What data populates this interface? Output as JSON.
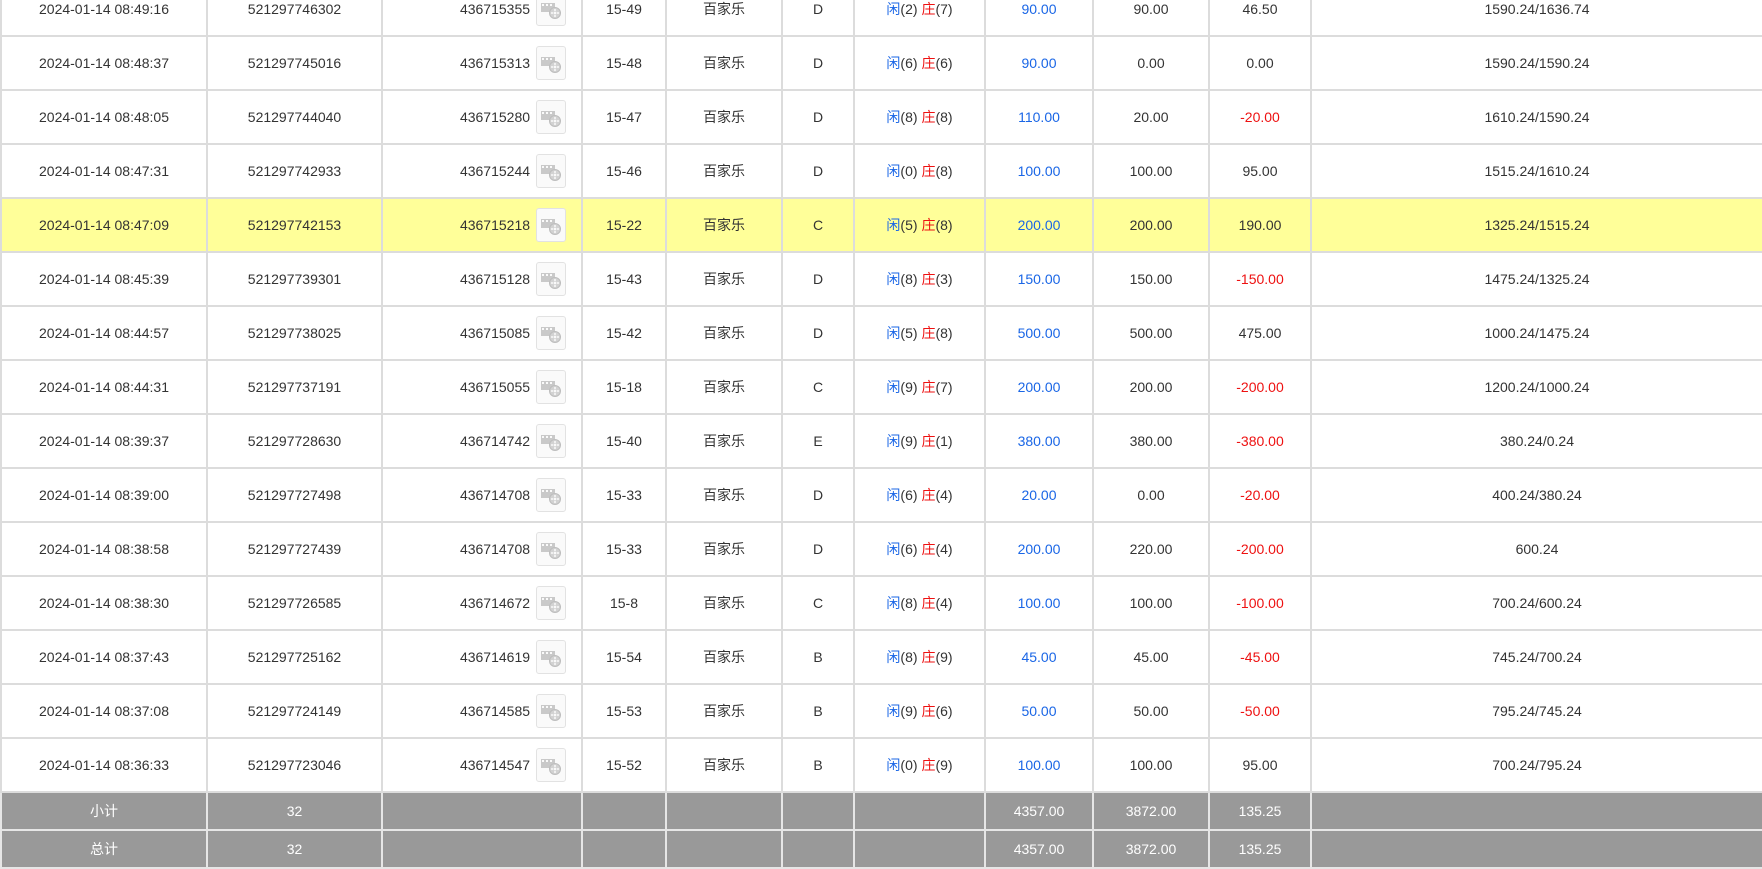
{
  "colors": {
    "player": "#1a66e6",
    "banker": "#ee1111",
    "loss": "#ee1111",
    "highlight": "#ffff99",
    "summary_bg": "#999999"
  },
  "icons": {
    "video": "film-reel-icon"
  },
  "labels": {
    "player": "闲",
    "banker": "庄"
  },
  "rows": [
    {
      "time": "2024-01-14 08:49:16",
      "order_id": "521297746302",
      "round_id": "436715355",
      "shoe": "15-49",
      "game": "百家乐",
      "table": "D",
      "player_pts": "(2)",
      "banker_pts": "(7)",
      "bet": "90.00",
      "valid_bet": "90.00",
      "win_loss": "46.50",
      "negative": false,
      "balance": "1590.24/1636.74",
      "highlight": false
    },
    {
      "time": "2024-01-14 08:48:37",
      "order_id": "521297745016",
      "round_id": "436715313",
      "shoe": "15-48",
      "game": "百家乐",
      "table": "D",
      "player_pts": "(6)",
      "banker_pts": "(6)",
      "bet": "90.00",
      "valid_bet": "0.00",
      "win_loss": "0.00",
      "negative": false,
      "balance": "1590.24/1590.24",
      "highlight": false
    },
    {
      "time": "2024-01-14 08:48:05",
      "order_id": "521297744040",
      "round_id": "436715280",
      "shoe": "15-47",
      "game": "百家乐",
      "table": "D",
      "player_pts": "(8)",
      "banker_pts": "(8)",
      "bet": "110.00",
      "valid_bet": "20.00",
      "win_loss": "-20.00",
      "negative": true,
      "balance": "1610.24/1590.24",
      "highlight": false
    },
    {
      "time": "2024-01-14 08:47:31",
      "order_id": "521297742933",
      "round_id": "436715244",
      "shoe": "15-46",
      "game": "百家乐",
      "table": "D",
      "player_pts": "(0)",
      "banker_pts": "(8)",
      "bet": "100.00",
      "valid_bet": "100.00",
      "win_loss": "95.00",
      "negative": false,
      "balance": "1515.24/1610.24",
      "highlight": false
    },
    {
      "time": "2024-01-14 08:47:09",
      "order_id": "521297742153",
      "round_id": "436715218",
      "shoe": "15-22",
      "game": "百家乐",
      "table": "C",
      "player_pts": "(5)",
      "banker_pts": "(8)",
      "bet": "200.00",
      "valid_bet": "200.00",
      "win_loss": "190.00",
      "negative": false,
      "balance": "1325.24/1515.24",
      "highlight": true
    },
    {
      "time": "2024-01-14 08:45:39",
      "order_id": "521297739301",
      "round_id": "436715128",
      "shoe": "15-43",
      "game": "百家乐",
      "table": "D",
      "player_pts": "(8)",
      "banker_pts": "(3)",
      "bet": "150.00",
      "valid_bet": "150.00",
      "win_loss": "-150.00",
      "negative": true,
      "balance": "1475.24/1325.24",
      "highlight": false
    },
    {
      "time": "2024-01-14 08:44:57",
      "order_id": "521297738025",
      "round_id": "436715085",
      "shoe": "15-42",
      "game": "百家乐",
      "table": "D",
      "player_pts": "(5)",
      "banker_pts": "(8)",
      "bet": "500.00",
      "valid_bet": "500.00",
      "win_loss": "475.00",
      "negative": false,
      "balance": "1000.24/1475.24",
      "highlight": false
    },
    {
      "time": "2024-01-14 08:44:31",
      "order_id": "521297737191",
      "round_id": "436715055",
      "shoe": "15-18",
      "game": "百家乐",
      "table": "C",
      "player_pts": "(9)",
      "banker_pts": "(7)",
      "bet": "200.00",
      "valid_bet": "200.00",
      "win_loss": "-200.00",
      "negative": true,
      "balance": "1200.24/1000.24",
      "highlight": false
    },
    {
      "time": "2024-01-14 08:39:37",
      "order_id": "521297728630",
      "round_id": "436714742",
      "shoe": "15-40",
      "game": "百家乐",
      "table": "E",
      "player_pts": "(9)",
      "banker_pts": "(1)",
      "bet": "380.00",
      "valid_bet": "380.00",
      "win_loss": "-380.00",
      "negative": true,
      "balance": "380.24/0.24",
      "highlight": false
    },
    {
      "time": "2024-01-14 08:39:00",
      "order_id": "521297727498",
      "round_id": "436714708",
      "shoe": "15-33",
      "game": "百家乐",
      "table": "D",
      "player_pts": "(6)",
      "banker_pts": "(4)",
      "bet": "20.00",
      "valid_bet": "0.00",
      "win_loss": "-20.00",
      "negative": true,
      "balance": "400.24/380.24",
      "highlight": false
    },
    {
      "time": "2024-01-14 08:38:58",
      "order_id": "521297727439",
      "round_id": "436714708",
      "shoe": "15-33",
      "game": "百家乐",
      "table": "D",
      "player_pts": "(6)",
      "banker_pts": "(4)",
      "bet": "200.00",
      "valid_bet": "220.00",
      "win_loss": "-200.00",
      "negative": true,
      "balance": "600.24",
      "highlight": false
    },
    {
      "time": "2024-01-14 08:38:30",
      "order_id": "521297726585",
      "round_id": "436714672",
      "shoe": "15-8",
      "game": "百家乐",
      "table": "C",
      "player_pts": "(8)",
      "banker_pts": "(4)",
      "bet": "100.00",
      "valid_bet": "100.00",
      "win_loss": "-100.00",
      "negative": true,
      "balance": "700.24/600.24",
      "highlight": false
    },
    {
      "time": "2024-01-14 08:37:43",
      "order_id": "521297725162",
      "round_id": "436714619",
      "shoe": "15-54",
      "game": "百家乐",
      "table": "B",
      "player_pts": "(8)",
      "banker_pts": "(9)",
      "bet": "45.00",
      "valid_bet": "45.00",
      "win_loss": "-45.00",
      "negative": true,
      "balance": "745.24/700.24",
      "highlight": false
    },
    {
      "time": "2024-01-14 08:37:08",
      "order_id": "521297724149",
      "round_id": "436714585",
      "shoe": "15-53",
      "game": "百家乐",
      "table": "B",
      "player_pts": "(9)",
      "banker_pts": "(6)",
      "bet": "50.00",
      "valid_bet": "50.00",
      "win_loss": "-50.00",
      "negative": true,
      "balance": "795.24/745.24",
      "highlight": false
    },
    {
      "time": "2024-01-14 08:36:33",
      "order_id": "521297723046",
      "round_id": "436714547",
      "shoe": "15-52",
      "game": "百家乐",
      "table": "B",
      "player_pts": "(0)",
      "banker_pts": "(9)",
      "bet": "100.00",
      "valid_bet": "100.00",
      "win_loss": "95.00",
      "negative": false,
      "balance": "700.24/795.24",
      "highlight": false
    }
  ],
  "summary": [
    {
      "label": "小计",
      "count": "32",
      "bet": "4357.00",
      "valid_bet": "3872.00",
      "win_loss": "135.25"
    },
    {
      "label": "总计",
      "count": "32",
      "bet": "4357.00",
      "valid_bet": "3872.00",
      "win_loss": "135.25"
    }
  ]
}
